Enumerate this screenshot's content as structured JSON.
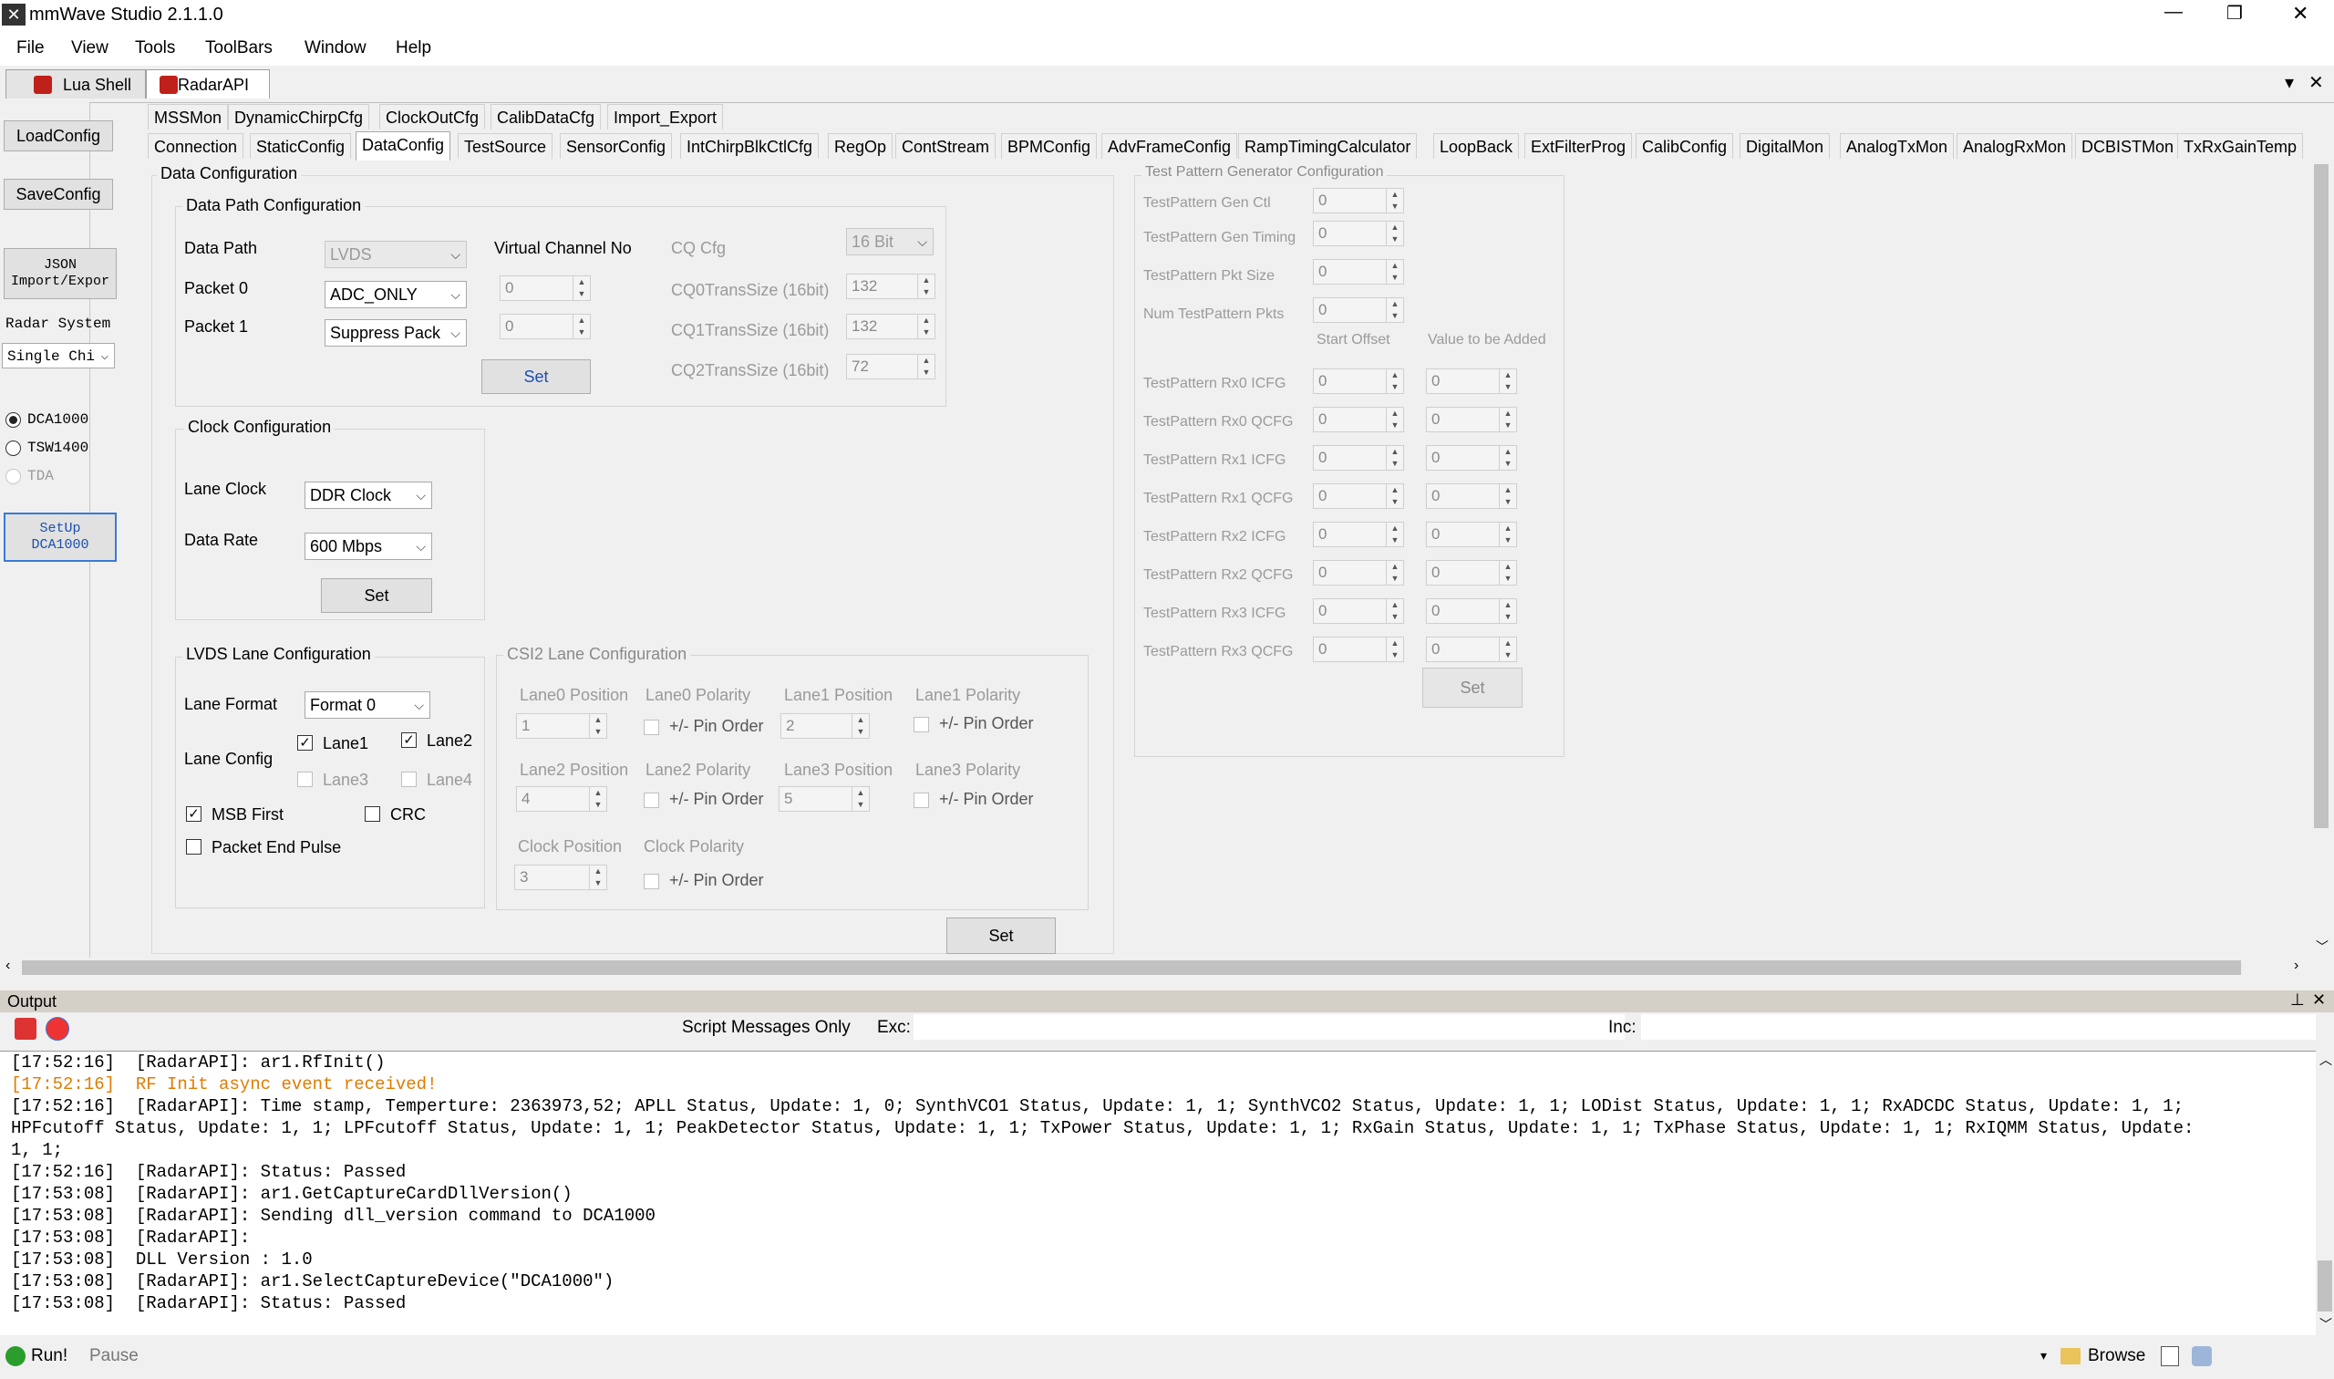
{
  "window": {
    "title": "mmWave Studio 2.1.1.0",
    "minimize": "—",
    "restore": "❐",
    "close": "✕"
  },
  "menu": [
    "File",
    "View",
    "Tools",
    "ToolBars",
    "Window",
    "Help"
  ],
  "doc_tabs": [
    {
      "label": "Lua Shell"
    },
    {
      "label": "RadarAPI"
    }
  ],
  "doc_tab_controls": {
    "dropdown": "▾",
    "close": "✕"
  },
  "left": {
    "load": "LoadConfig",
    "save": "SaveConfig",
    "json_line1": "JSON",
    "json_line2": "Import/Expor",
    "radar_system_label": "Radar System",
    "radar_system_value": "Single Chi",
    "radios": [
      {
        "label": "DCA1000",
        "selected": true
      },
      {
        "label": "TSW1400",
        "selected": false
      },
      {
        "label": "TDA",
        "selected": false,
        "disabled": true
      }
    ],
    "setup_line1": "SetUp",
    "setup_line2": "DCA1000"
  },
  "tabs_row1": [
    "MSSMon",
    "DynamicChirpCfg",
    "ClockOutCfg",
    "CalibDataCfg",
    "Import_Export"
  ],
  "tabs_row2": [
    "Connection",
    "StaticConfig",
    "DataConfig",
    "TestSource",
    "SensorConfig",
    "IntChirpBlkCtlCfg",
    "RegOp",
    "ContStream",
    "BPMConfig",
    "AdvFrameConfig",
    "RampTimingCalculator",
    "LoopBack",
    "ExtFilterProg",
    "CalibConfig",
    "DigitalMon",
    "AnalogTxMon",
    "AnalogRxMon",
    "DCBISTMon",
    "TxRxGainTemp"
  ],
  "data_config": {
    "title": "Data Configuration",
    "path": {
      "title": "Data Path Configuration",
      "data_path_label": "Data Path",
      "data_path_value": "LVDS",
      "packet0_label": "Packet 0",
      "packet0_value": "ADC_ONLY",
      "packet1_label": "Packet 1",
      "packet1_value": "Suppress Pack",
      "vc_label": "Virtual Channel No",
      "vc0": "0",
      "vc1": "0",
      "cq_cfg_label": "CQ Cfg",
      "cq_cfg_value": "16 Bit",
      "cq0_label": "CQ0TransSize (16bit)",
      "cq0_value": "132",
      "cq1_label": "CQ1TransSize (16bit)",
      "cq1_value": "132",
      "cq2_label": "CQ2TransSize (16bit)",
      "cq2_value": "72",
      "set": "Set"
    },
    "clock": {
      "title": "Clock Configuration",
      "lane_clock_label": "Lane Clock",
      "lane_clock_value": "DDR Clock",
      "data_rate_label": "Data Rate",
      "data_rate_value": "600 Mbps",
      "set": "Set"
    },
    "lvds": {
      "title": "LVDS Lane Configuration",
      "lane_format_label": "Lane Format",
      "lane_format_value": "Format 0",
      "lane_config_label": "Lane Config",
      "lane1": "Lane1",
      "lane2": "Lane2",
      "lane3": "Lane3",
      "lane4": "Lane4",
      "msb_first": "MSB First",
      "crc": "CRC",
      "packet_end_pulse": "Packet End Pulse"
    },
    "csi2": {
      "title": "CSI2 Lane Configuration",
      "lane0_pos": "Lane0 Position",
      "lane0_pos_value": "1",
      "lane0_pol": "Lane0 Polarity",
      "lane1_pos": "Lane1 Position",
      "lane1_pos_value": "2",
      "lane1_pol": "Lane1 Polarity",
      "lane2_pos": "Lane2 Position",
      "lane2_pos_value": "4",
      "lane2_pol": "Lane2 Polarity",
      "lane3_pos": "Lane3 Position",
      "lane3_pos_value": "5",
      "lane3_pol": "Lane3 Polarity",
      "clock_pos": "Clock Position",
      "clock_pos_value": "3",
      "clock_pol": "Clock Polarity",
      "pin_order": "+/- Pin Order"
    },
    "set": "Set"
  },
  "test_pattern": {
    "title": "Test Pattern Generator Configuration",
    "gen_ctl": "TestPattern Gen Ctl",
    "gen_ctl_value": "0",
    "gen_timing": "TestPattern Gen Timing",
    "gen_timing_value": "0",
    "pkt_size": "TestPattern Pkt Size",
    "pkt_size_value": "0",
    "num_pkts": "Num TestPattern Pkts",
    "num_pkts_value": "0",
    "start_offset": "Start Offset",
    "value_added": "Value to be Added",
    "rows": [
      {
        "label": "TestPattern Rx0 ICFG",
        "a": "0",
        "b": "0"
      },
      {
        "label": "TestPattern Rx0 QCFG",
        "a": "0",
        "b": "0"
      },
      {
        "label": "TestPattern Rx1 ICFG",
        "a": "0",
        "b": "0"
      },
      {
        "label": "TestPattern Rx1 QCFG",
        "a": "0",
        "b": "0"
      },
      {
        "label": "TestPattern Rx2 ICFG",
        "a": "0",
        "b": "0"
      },
      {
        "label": "TestPattern Rx2 QCFG",
        "a": "0",
        "b": "0"
      },
      {
        "label": "TestPattern Rx3 ICFG",
        "a": "0",
        "b": "0"
      },
      {
        "label": "TestPattern Rx3 QCFG",
        "a": "0",
        "b": "0"
      }
    ],
    "set": "Set"
  },
  "output": {
    "title": "Output",
    "pin": "⊥",
    "close": "✕",
    "script_messages_only": "Script Messages Only",
    "exc": "Exc:",
    "inc": "Inc:",
    "lines": [
      "[17:52:16]  [RadarAPI]: ar1.RfInit()",
      "[17:52:16]  RF Init async event received!",
      "[17:52:16]  [RadarAPI]: Time stamp, Temperture: 2363973,52; APLL Status, Update: 1, 0; SynthVCO1 Status, Update: 1, 1; SynthVCO2 Status, Update: 1, 1; LODist Status, Update: 1, 1; RxADCDC Status, Update: 1, 1;",
      "HPFcutoff Status, Update: 1, 1; LPFcutoff Status, Update: 1, 1; PeakDetector Status, Update: 1, 1; TxPower Status, Update: 1, 1; RxGain Status, Update: 1, 1; TxPhase Status, Update: 1, 1; RxIQMM Status, Update:",
      "1, 1;",
      "[17:52:16]  [RadarAPI]: Status: Passed",
      "[17:53:08]  [RadarAPI]: ar1.GetCaptureCardDllVersion()",
      "[17:53:08]  [RadarAPI]: Sending dll_version command to DCA1000",
      "[17:53:08]  [RadarAPI]:",
      "[17:53:08]  DLL Version : 1.0",
      "[17:53:08]  [RadarAPI]: ar1.SelectCaptureDevice(\"DCA1000\")",
      "[17:53:08]  [RadarAPI]: Status: Passed"
    ],
    "event_color": "#e07b00"
  },
  "status": {
    "run": "Run!",
    "pause": "Pause",
    "browse": "Browse"
  }
}
